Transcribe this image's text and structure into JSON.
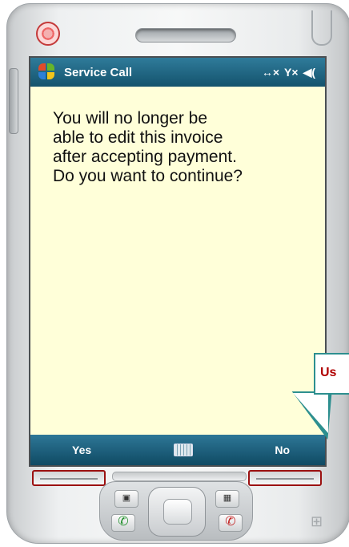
{
  "title_bar": {
    "app_title": "Service Call",
    "status": {
      "sync_icon": "↔×",
      "signal_icon": "Y×",
      "volume_icon": "◀("
    }
  },
  "dialog": {
    "message": "You will no longer be\nable to edit this invoice\nafter accepting payment.\nDo you want to continue?"
  },
  "softkeys": {
    "left": "Yes",
    "right": "No"
  },
  "callout": {
    "text": "Us"
  },
  "colors": {
    "screen_bg": "#ffffd9",
    "bar_dark": "#14536d",
    "highlight_red": "#9b1111",
    "callout_border": "#2d8f8f"
  },
  "icons": {
    "start": "windows-flag-icon",
    "keyboard": "keyboard-icon",
    "call": "phone-call-icon",
    "end": "phone-end-icon"
  }
}
